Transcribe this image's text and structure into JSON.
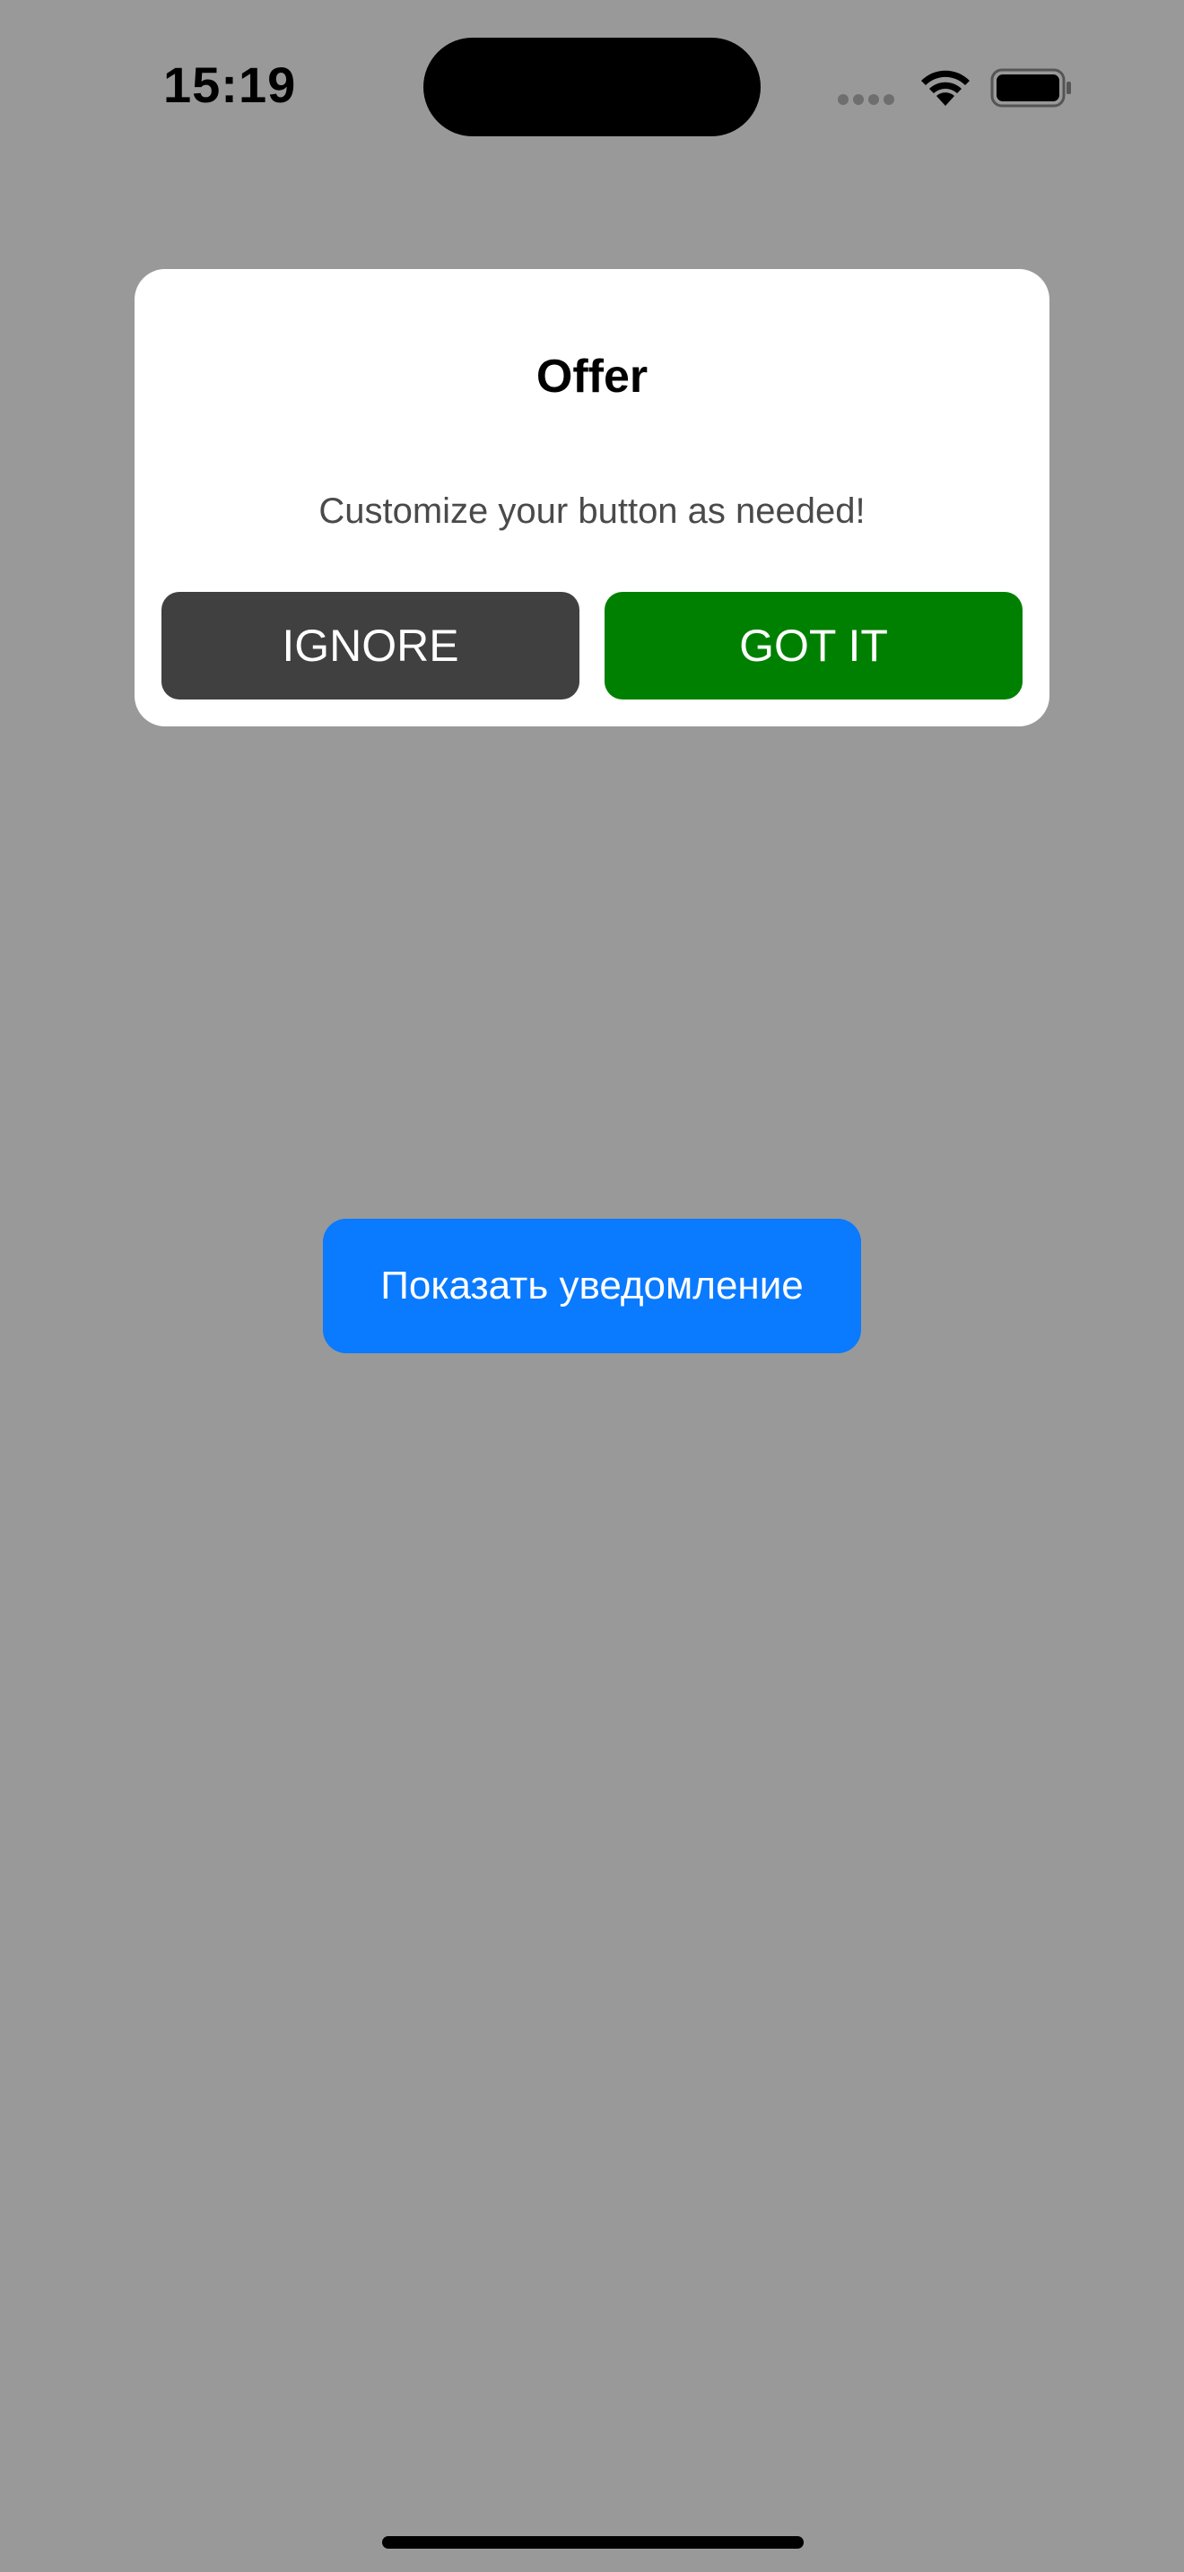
{
  "status_bar": {
    "time": "15:19",
    "icons": [
      "signal-dots-icon",
      "wifi-icon",
      "battery-icon"
    ]
  },
  "dialog": {
    "title": "Offer",
    "message": "Customize your button as needed!",
    "ignore_label": "IGNORE",
    "got_it_label": "GOT IT",
    "colors": {
      "ignore_bg": "#404040",
      "got_it_bg": "#008000"
    }
  },
  "main": {
    "show_notification_label": "Показать уведомление",
    "button_color": "#0a7aff"
  },
  "colors": {
    "background": "#999999",
    "card": "#ffffff"
  }
}
